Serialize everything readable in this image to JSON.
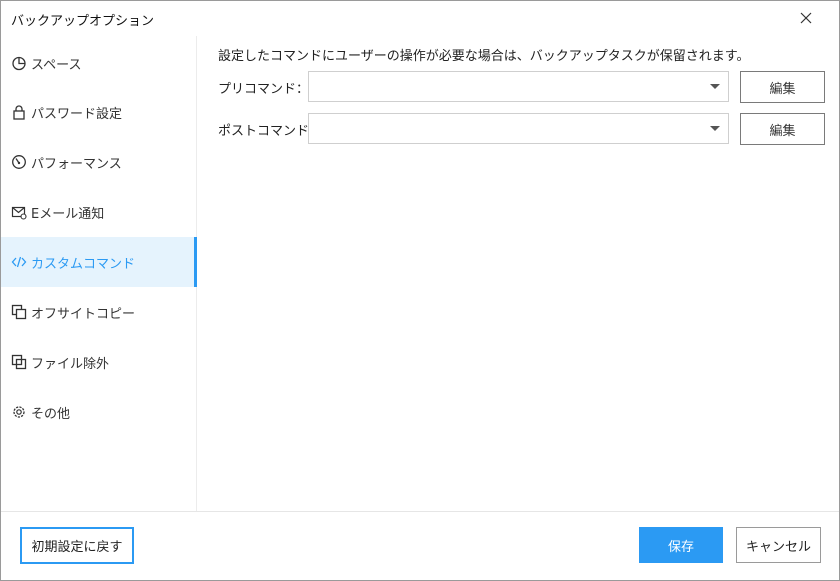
{
  "window": {
    "title": "バックアップオプション"
  },
  "sidebar": {
    "items": [
      {
        "label": "スペース",
        "icon": "pie-chart-icon"
      },
      {
        "label": "パスワード設定",
        "icon": "lock-icon"
      },
      {
        "label": "パフォーマンス",
        "icon": "speedometer-icon"
      },
      {
        "label": "Eメール通知",
        "icon": "mail-alert-icon"
      },
      {
        "label": "カスタムコマンド",
        "icon": "code-icon",
        "active": true
      },
      {
        "label": "オフサイトコピー",
        "icon": "copy-icon"
      },
      {
        "label": "ファイル除外",
        "icon": "exclude-files-icon"
      },
      {
        "label": "その他",
        "icon": "gear-icon"
      }
    ]
  },
  "main": {
    "notice": "設定したコマンドにユーザーの操作が必要な場合は、バックアップタスクが保留されます。",
    "pre_command": {
      "label": "プリコマンド：",
      "value": "",
      "edit_label": "編集"
    },
    "post_command": {
      "label": "ポストコマンド：",
      "value": "",
      "edit_label": "編集"
    }
  },
  "footer": {
    "reset_label": "初期設定に戻す",
    "save_label": "保存",
    "cancel_label": "キャンセル"
  },
  "colors": {
    "accent": "#2b9af3",
    "active_bg": "#e5f3fd"
  }
}
